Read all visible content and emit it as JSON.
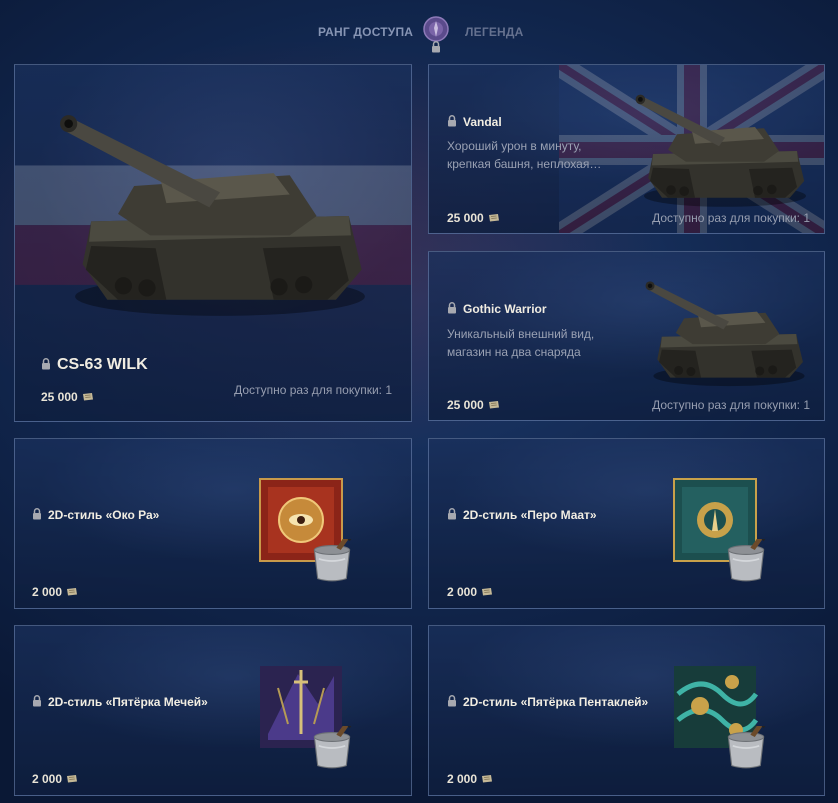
{
  "header": {
    "rank_label": "РАНГ ДОСТУПА",
    "legend_label": "ЛЕГЕНДА",
    "emblem_icon": "rank-emblem-icon",
    "lock_icon": "lock-icon"
  },
  "colors": {
    "background": "#11264d",
    "card_border": "#8aa0cd",
    "price_icon": "#c4b896"
  },
  "cards": {
    "main": {
      "name": "CS-63 WILK",
      "price": "25 000",
      "availability": "Доступно раз для покупки: 1",
      "locked": true
    },
    "vandal": {
      "name": "Vandal",
      "description": "Хороший урон в минуту, крепкая башня, неплохая…",
      "price": "25 000",
      "availability": "Доступно раз для покупки: 1",
      "locked": true
    },
    "gothic": {
      "name": "Gothic Warrior",
      "description": "Уникальный внешний вид, магазин на два снаряда",
      "price": "25 000",
      "availability": "Доступно раз для покупки: 1",
      "locked": true
    },
    "oko": {
      "name": "2D-стиль «Око Ра»",
      "price": "2 000",
      "locked": true
    },
    "pero": {
      "name": "2D-стиль «Перо Маат»",
      "price": "2 000",
      "locked": true
    },
    "swords": {
      "name": "2D-стиль «Пятёрка Мечей»",
      "price": "2 000",
      "locked": true
    },
    "pentacles": {
      "name": "2D-стиль «Пятёрка Пентаклей»",
      "price": "2 000",
      "locked": true
    }
  }
}
